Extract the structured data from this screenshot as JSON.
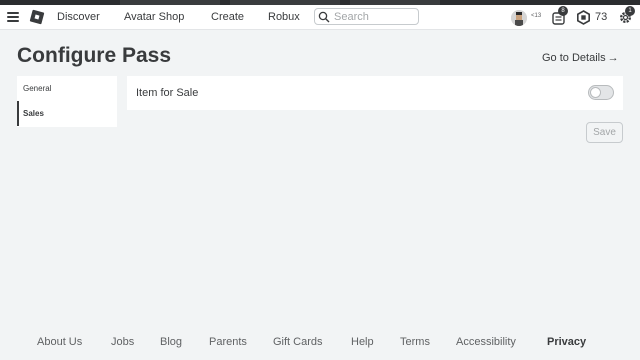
{
  "header": {
    "nav": [
      "Discover",
      "Avatar Shop",
      "Create",
      "Robux"
    ],
    "search_placeholder": "Search",
    "age_label": "<13",
    "notifications_count": "8",
    "robux_amount": "73",
    "settings_badge": "1"
  },
  "page": {
    "title": "Configure Pass",
    "details_link": "Go to Details"
  },
  "sidebar": {
    "items": [
      {
        "label": "General",
        "active": false
      },
      {
        "label": "Sales",
        "active": true
      }
    ]
  },
  "sales": {
    "item_for_sale_label": "Item for Sale",
    "item_for_sale_enabled": false,
    "save_label": "Save"
  },
  "footer": {
    "links": [
      "About Us",
      "Jobs",
      "Blog",
      "Parents",
      "Gift Cards",
      "Help",
      "Terms",
      "Accessibility",
      "Privacy"
    ]
  },
  "colors": {
    "background": "#f2f4f5",
    "surface": "#ffffff",
    "text": "#393b3d",
    "muted": "#a3a6a8"
  }
}
